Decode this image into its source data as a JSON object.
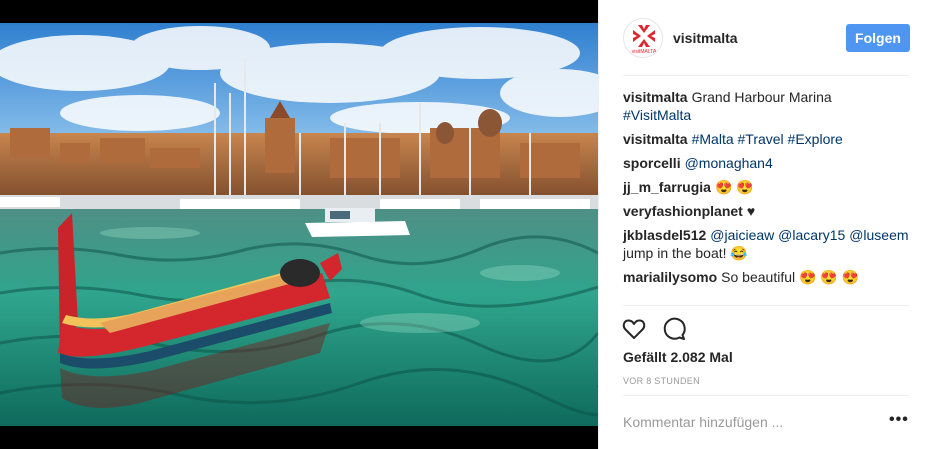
{
  "post": {
    "username": "visitmalta",
    "follow_label": "Folgen",
    "avatar_text": "visitMALTA",
    "photo_alt": "",
    "likes_text": "Gefällt 2.082 Mal",
    "timestamp": "VOR 8 STUNDEN",
    "comment_placeholder": "Kommentar hinzufügen ...",
    "more_label": "•••"
  },
  "comments": [
    {
      "author": "visitmalta",
      "text": "Grand Harbour Marina",
      "tags": "#VisitMalta"
    },
    {
      "author": "visitmalta",
      "text": "",
      "tags": "#Malta #Travel #Explore"
    },
    {
      "author": "sporcelli",
      "text": "",
      "tags": "@monaghan4"
    },
    {
      "author": "jj_m_farrugia",
      "text": "😍 😍",
      "tags": ""
    },
    {
      "author": "veryfashionplanet",
      "text": "♥",
      "tags": ""
    },
    {
      "author": "jkblasdel512",
      "text": "",
      "tags": "@jaicieaw @lacary15 @luseem",
      "text2": "jump in the boat! 😂"
    },
    {
      "author": "marialilysomo",
      "text": "So beautiful 😍 😍 😍",
      "tags": ""
    }
  ],
  "icons": {
    "like": "heart-icon",
    "comment": "comment-bubble-icon",
    "more": "more-options-icon"
  },
  "colors": {
    "follow_button": "#4e96f1",
    "hashtag": "#003569",
    "avatar_red": "#e0262f"
  }
}
